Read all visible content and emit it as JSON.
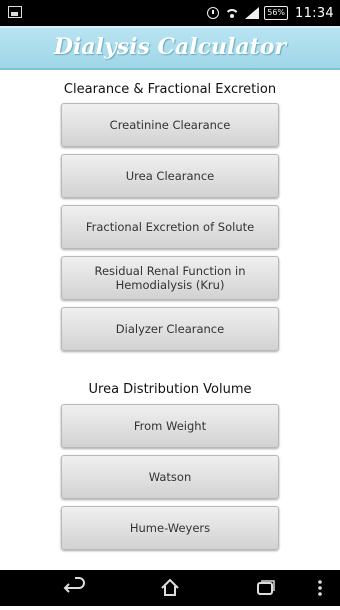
{
  "status_bar": {
    "battery": "56%",
    "time": "11:34"
  },
  "app": {
    "title": "Dialysis Calculator"
  },
  "sections": [
    {
      "heading": "Clearance & Fractional Excretion",
      "buttons": [
        "Creatinine Clearance",
        "Urea Clearance",
        "Fractional Excretion of Solute",
        "Residual Renal Function in Hemodialysis (Kru)",
        "Dialyzer Clearance"
      ]
    },
    {
      "heading": "Urea Distribution Volume",
      "buttons": [
        "From Weight",
        "Watson",
        "Hume-Weyers"
      ]
    }
  ],
  "nav_icons": [
    "back-icon",
    "home-icon",
    "recent-apps-icon",
    "overflow-menu-icon"
  ]
}
